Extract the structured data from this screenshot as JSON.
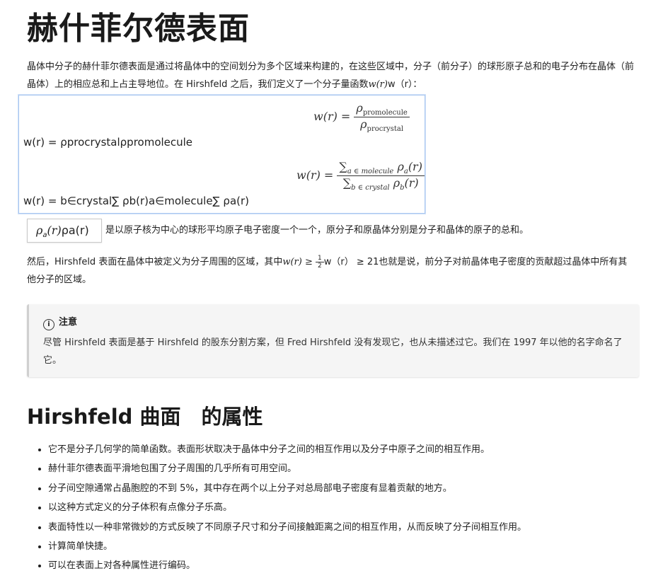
{
  "title": "赫什菲尔德表面",
  "intro": {
    "text": "晶体中分子的赫什菲尔德表面是通过将晶体中的空间划分为多个区域来构建的，在这些区域中，分子（前分子）的球形原子总和的电子分布在晶体（前晶体）上的相应总和上占主导地位。在 Hirshfeld 之后，我们定义了一个分子量函数",
    "math": "w(r)",
    "tail": "w（r）："
  },
  "equations": {
    "line1_text": "w(r) = ρprocrystalρpromolecule",
    "line2_text": "w(r) = b∈crystal∑ ρb(r)a∈molecule∑ ρa(r)",
    "eq1": {
      "lhs": "w(r) =",
      "num": "ρ",
      "num_sub": "promolecule",
      "den": "ρ",
      "den_sub": "procrystal"
    },
    "eq2": {
      "lhs": "w(r) =",
      "num": "∑",
      "num_sub": "a ∈ molecule",
      "num_rest": "ρ",
      "num_rest_sub": "a",
      "num_arg": "(r)",
      "den": "∑",
      "den_sub": "b ∈ crystal",
      "den_rest": "ρ",
      "den_rest_sub": "b",
      "den_arg": "(r)"
    }
  },
  "rho_line": {
    "box_math": "ρ",
    "box_math_sub": "a",
    "box_math_arg": "(r)",
    "box_text": "ρa(r)",
    "text": "是以原子核为中心的球形平均原子电子密度一个一个，原分子和原晶体分别是分子和晶体的原子的总和。"
  },
  "hirshfeld_def": {
    "text_a": "然后，Hirshfeld 表面在晶体中被定义为分子周围的区域，其中",
    "math": "w(r) ≥",
    "frac_num": "1",
    "frac_den": "2",
    "text_b": "w（r） ≥ 21也就是说，前分子对前晶体电子密度的贡献超过晶体中所有其他分子的区域。"
  },
  "note": {
    "icon": "i",
    "title": "注意",
    "body": "尽管 Hirshfeld 表面是基于 Hirshfeld 的股东分割方案，但 Fred Hirshfeld 没有发现它，也从未描述过它。我们在 1997 年以他的名字命名了它。"
  },
  "section2_title": "Hirshfeld 曲面　的属性",
  "properties": [
    "它不是分子几何学的简单函数。表面形状取决于晶体中分子之间的相互作用以及分子中原子之间的相互作用。",
    "赫什菲尔德表面平滑地包围了分子周围的几乎所有可用空间。",
    "分子间空隙通常占晶胞腔的不到 5%，其中存在两个以上分子对总局部电子密度有显着贡献的地方。",
    "以这种方式定义的分子体积有点像分子乐高。",
    "表面特性以一种非常微妙的方式反映了不同原子尺寸和分子间接触距离之间的相互作用，从而反映了分子间相互作用。",
    "计算简单快捷。",
    "可以在表面上对各种属性进行编码。"
  ]
}
